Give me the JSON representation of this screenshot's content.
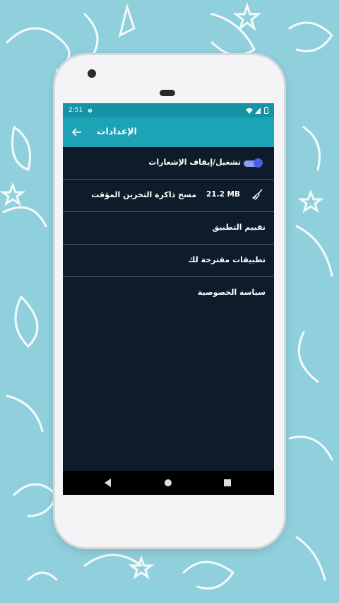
{
  "status_bar": {
    "time": "2:51",
    "icons": [
      "gear-icon",
      "wifi-icon",
      "signal-icon",
      "battery-icon"
    ]
  },
  "app_bar": {
    "title": "الإعدادات",
    "back_icon": "arrow-back-icon",
    "color": "#1ca3b6"
  },
  "settings": {
    "notifications_label": "تشغيل/إيقاف الإشعارات",
    "notifications_enabled": true,
    "clear_cache_label": "مسح ذاكرة التخزين المؤقت",
    "cache_size": "21.2 MB",
    "rate_app_label": "تقييم التطبيق",
    "suggested_apps_label": "تطبيقات مقترحة لك",
    "privacy_policy_label": "سياسة الخصوصية"
  },
  "nav_bar": {
    "icons": [
      "back-triangle-icon",
      "home-circle-icon",
      "recents-square-icon"
    ]
  },
  "colors": {
    "background": "#8fd0dc",
    "screen": "#0d1b2a",
    "toggle_accent": "#4a5fe0"
  }
}
